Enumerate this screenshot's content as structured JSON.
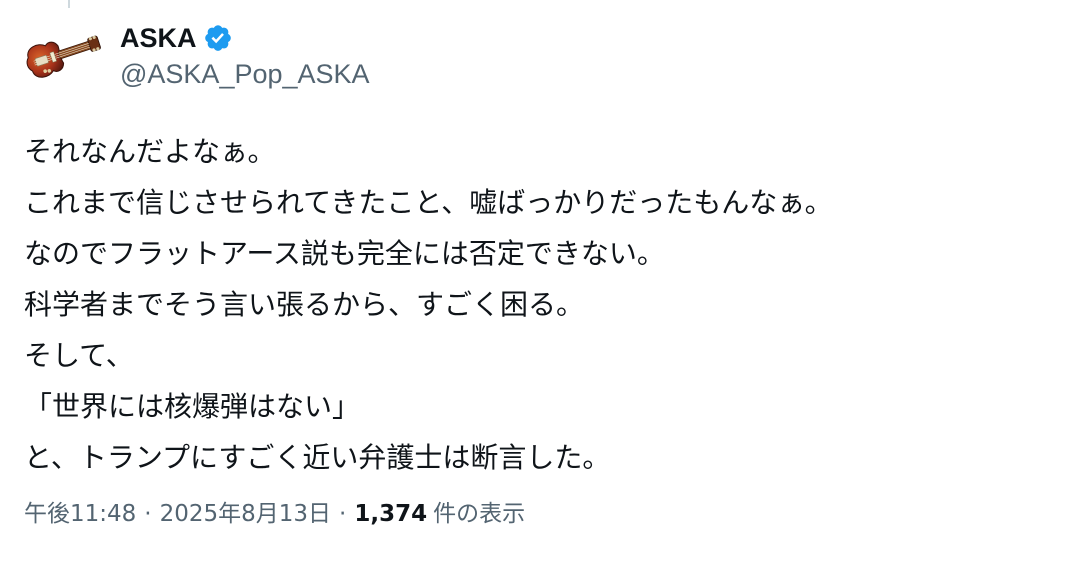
{
  "user": {
    "display_name": "ASKA",
    "handle": "@ASKA_Pop_ASKA",
    "verified_icon": "verified-badge-icon",
    "avatar_icon": "violin-bass-avatar"
  },
  "tweet": {
    "lines": [
      "それなんだよなぁ。",
      "これまで信じさせられてきたこと、嘘ばっかりだったもんなぁ。",
      "なのでフラットアース説も完全には否定できない。",
      "科学者までそう言い張るから、すごく困る。",
      "そして、",
      "「世界には核爆弾はない」",
      "と、トランプにすごく近い弁護士は断言した。"
    ]
  },
  "meta": {
    "time": "午後11:48",
    "separator": "·",
    "date": "2025年8月13日",
    "views_count": "1,374",
    "views_label": "件の表示"
  },
  "colors": {
    "text": "#0f1419",
    "secondary": "#536471",
    "verified": "#1d9bf0"
  }
}
